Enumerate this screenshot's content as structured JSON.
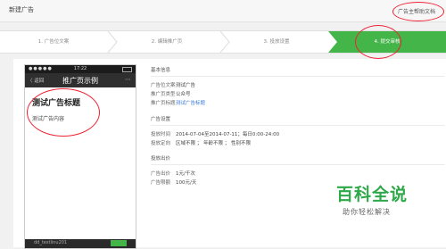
{
  "header": {
    "title": "新建广告",
    "help": "广告主帮助文档"
  },
  "steps": [
    {
      "label": "1. 广告位文案"
    },
    {
      "label": "2. 编辑推广页"
    },
    {
      "label": "3. 投放设置"
    },
    {
      "label": "4. 提交审核",
      "active": true
    }
  ],
  "phone": {
    "time": "17:22",
    "back": "〈 返回",
    "title": "推广页示例",
    "menu": "⋯",
    "ad_title": "测试广告标题",
    "ad_content": "测试广告内容",
    "bottom_user": "dd_testlinu201"
  },
  "info": {
    "basic": {
      "heading": "基本信息",
      "rows": [
        {
          "label": "广告位文案",
          "value": "测试广告"
        },
        {
          "label": "推广页类型",
          "value": "公众号"
        },
        {
          "label": "推广页标题",
          "value": "测试广告标题",
          "link": true
        }
      ]
    },
    "settings": {
      "heading": "广告设置",
      "rows": [
        {
          "label": "投放时间",
          "value": "2014-07-04至2014-07-11；每日0:00-24:00"
        },
        {
          "label": "投放定向",
          "value": "区域不限 ； 年龄不限 ； 性别不限"
        }
      ]
    },
    "bid": {
      "heading": "投放出价",
      "rows": [
        {
          "label": "广告出价",
          "value": "1元/千次"
        },
        {
          "label": "广告限额",
          "value": "100元/天"
        }
      ]
    }
  },
  "watermark": {
    "title": "百科全说",
    "subtitle": "助你轻松解决"
  },
  "colors": {
    "accent": "#44b549",
    "annotation": "#e22233",
    "link": "#3a7bd5"
  }
}
